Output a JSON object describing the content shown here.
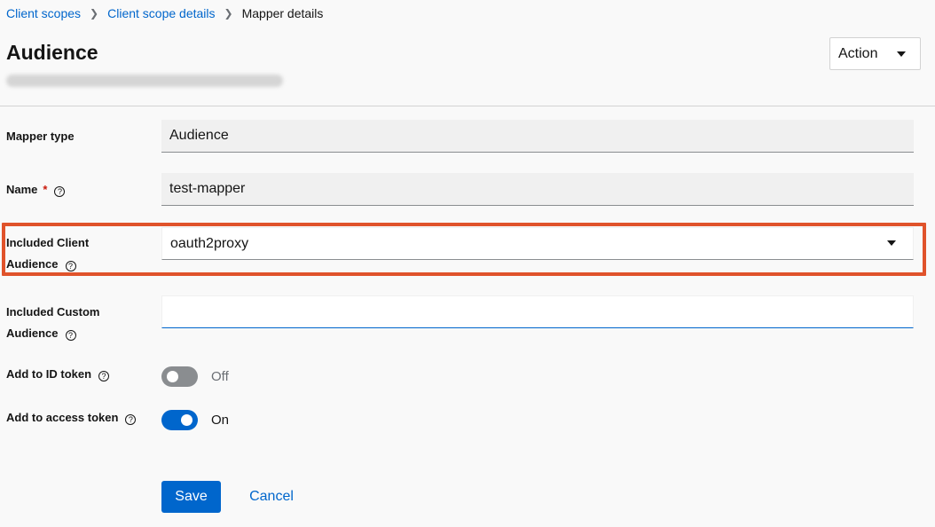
{
  "breadcrumb": {
    "items": [
      "Client scopes",
      "Client scope details"
    ],
    "current": "Mapper details"
  },
  "header": {
    "title": "Audience",
    "action_label": "Action"
  },
  "form": {
    "mapper_type": {
      "label": "Mapper type",
      "value": "Audience"
    },
    "name": {
      "label": "Name",
      "required_mark": "*",
      "value": "test-mapper"
    },
    "included_client_audience": {
      "label_line1": "Included Client",
      "label_line2": "Audience",
      "value": "oauth2proxy"
    },
    "included_custom_audience": {
      "label_line1": "Included Custom",
      "label_line2": "Audience",
      "value": ""
    },
    "add_to_id_token": {
      "label": "Add to ID token",
      "state": "Off"
    },
    "add_to_access_token": {
      "label": "Add to access token",
      "state": "On"
    }
  },
  "icons": {
    "help": "?"
  },
  "actions": {
    "save_label": "Save",
    "cancel_label": "Cancel"
  },
  "colors": {
    "accent": "#0066cc",
    "highlight": "#e0532b",
    "required": "#c9190b"
  }
}
